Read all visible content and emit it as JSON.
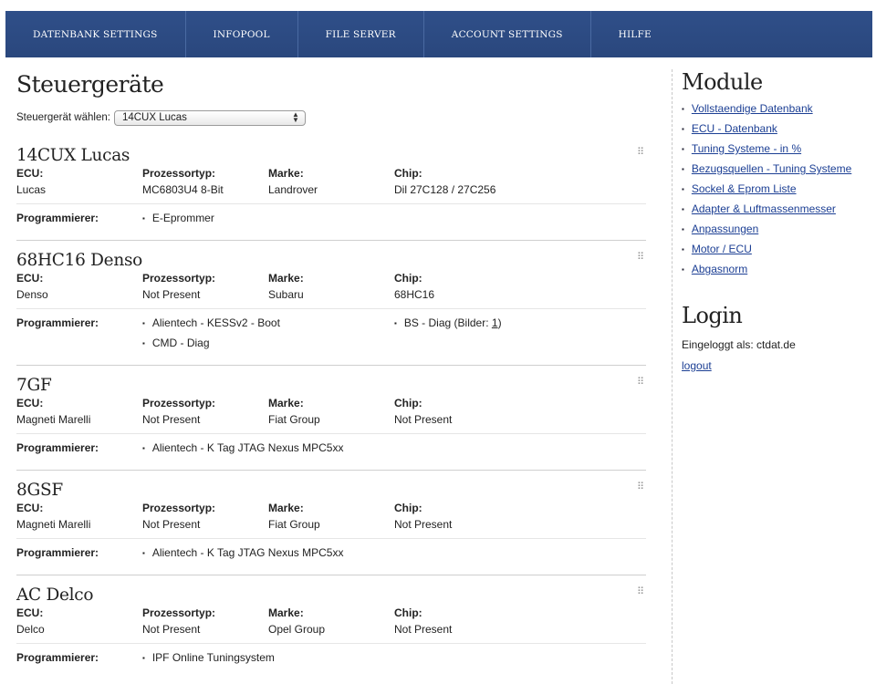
{
  "nav": {
    "items": [
      "DATENBANK SETTINGS",
      "INFOPOOL",
      "FILE SERVER",
      "ACCOUNT SETTINGS",
      "HILFE"
    ]
  },
  "main": {
    "title": "Steuergeräte",
    "select_label": "Steuergerät wählen:",
    "select_value": "14CUX Lucas",
    "headers": {
      "ecu": "ECU:",
      "proc": "Prozessortyp:",
      "brand": "Marke:",
      "chip": "Chip:",
      "prog": "Programmierer:"
    },
    "ecus": [
      {
        "name": "14CUX Lucas",
        "ecu": "Lucas",
        "proc": "MC6803U4 8-Bit",
        "brand": "Landrover",
        "chip": "Dil 27C128 / 27C256",
        "prog_col1": [
          "E-Eprommer"
        ]
      },
      {
        "name": "68HC16 Denso",
        "ecu": "Denso",
        "proc": "Not Present",
        "brand": "Subaru",
        "chip": "68HC16",
        "prog_col1": [
          "Alientech - KESSv2 - Boot",
          "CMD - Diag"
        ],
        "prog_col2_text": "BS - Diag (Bilder: ",
        "prog_col2_link": "1",
        "prog_col2_end": ")"
      },
      {
        "name": "7GF",
        "ecu": "Magneti Marelli",
        "proc": "Not Present",
        "brand": "Fiat Group",
        "chip": "Not Present",
        "prog_col1": [
          "Alientech - K Tag JTAG Nexus MPC5xx"
        ]
      },
      {
        "name": "8GSF",
        "ecu": "Magneti Marelli",
        "proc": "Not Present",
        "brand": "Fiat Group",
        "chip": "Not Present",
        "prog_col1": [
          "Alientech - K Tag JTAG Nexus MPC5xx"
        ]
      },
      {
        "name": "AC Delco",
        "ecu": "Delco",
        "proc": "Not Present",
        "brand": "Opel Group",
        "chip": "Not Present",
        "prog_col1": [
          "IPF Online Tuningsystem"
        ]
      }
    ]
  },
  "sidebar": {
    "modules_title": "Module",
    "modules": [
      "Vollstaendige Datenbank",
      "ECU - Datenbank",
      "Tuning Systeme - in %",
      "Bezugsquellen - Tuning Systeme",
      "Sockel & Eprom Liste",
      "Adapter & Luftmassenmesser",
      "Anpassungen",
      "Motor / ECU",
      "Abgasnorm"
    ],
    "login_title": "Login",
    "logged_in_text": "Eingeloggt als: ctdat.de",
    "logout_label": "logout"
  },
  "colors": {
    "nav_bg": "#2c4a82",
    "link": "#1c3f94"
  },
  "icons": {
    "drag_handle": "drag-handle-icon",
    "select_arrows": "select-arrows-icon"
  }
}
